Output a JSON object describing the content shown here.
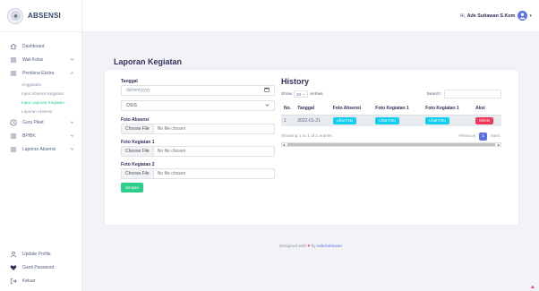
{
  "brand": {
    "title": "ABSENSI"
  },
  "sidebar": {
    "items": [
      {
        "label": "Dashboard",
        "icon": "home-icon"
      },
      {
        "label": "Wali Kelas",
        "icon": "list-icon"
      },
      {
        "label": "Pembina Ekstra",
        "icon": "list-icon"
      }
    ],
    "sub_items": [
      {
        "label": "Anggotaku"
      },
      {
        "label": "Input Absensi Kegiatan"
      },
      {
        "label": "Input Laporan Kegiatan",
        "active": true
      },
      {
        "label": "Laporan Absensi"
      }
    ],
    "items2": [
      {
        "label": "Guru Piket",
        "icon": "clock-icon"
      },
      {
        "label": "BP/BK",
        "icon": "list-icon"
      },
      {
        "label": "Laporan Absensi",
        "icon": "list-icon"
      }
    ],
    "bottom": [
      {
        "label": "Update Profile",
        "icon": "user-icon"
      },
      {
        "label": "Ganti Password",
        "icon": "heart-icon"
      },
      {
        "label": "Keluar",
        "icon": "logout-icon"
      }
    ]
  },
  "header": {
    "greeting_prefix": "Hi, ",
    "user_name": "Ade Sutiawan S.Kom"
  },
  "page": {
    "title": "Laporan Kegiatan"
  },
  "form": {
    "tanggal_label": "Tanggal",
    "tanggal_placeholder": "dd/mm/yyyy",
    "select_value": "OSIS",
    "foto_absensi_label": "Foto Absensi",
    "foto_kegiatan1_label": "Foto Kegiatan 1",
    "foto_kegiatan2_label": "Foto Kegiatan 2",
    "choose_file": "Choose File",
    "no_file": "No file chosen",
    "save_label": "Simpan"
  },
  "history": {
    "title": "History",
    "show_label": "Show",
    "entries_value": "10",
    "entries_label": "entries",
    "search_label": "Search:",
    "columns": [
      "No.",
      "Tanggal",
      "Foto Absensi",
      "Foto Kegiatan 1",
      "Foto Kegiatan 1",
      "Aksi"
    ],
    "rows": [
      {
        "no": "1",
        "tanggal": "2022-01-21",
        "foto_absensi": "Lihat Foto",
        "foto_kegiatan1": "Lihat Foto",
        "foto_kegiatan2": "Lihat Foto",
        "aksi": "Delete"
      }
    ],
    "info": "Showing 1 to 1 of 1 entries",
    "previous": "Previous",
    "page": "1",
    "next": "Next"
  },
  "footer": {
    "prefix": "Designed with",
    "middle": "by",
    "author": "AdeSutiawan"
  },
  "colors": {
    "primary": "#5e72e4",
    "success": "#2dce89",
    "info": "#11cdef",
    "danger": "#f5365c"
  }
}
